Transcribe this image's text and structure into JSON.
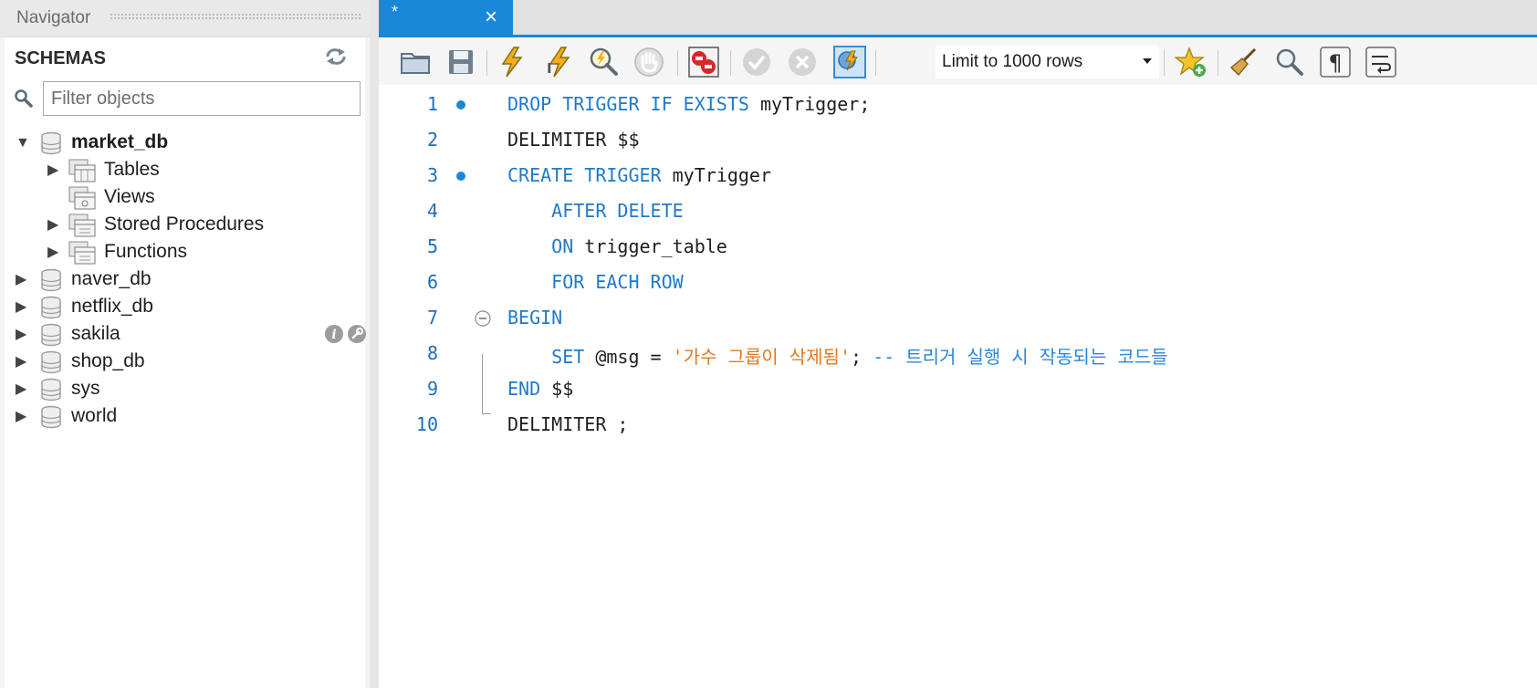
{
  "navigator": {
    "title": "Navigator",
    "schemas_label": "SCHEMAS",
    "filter_placeholder": "Filter objects",
    "tree": {
      "market_db": {
        "name": "market_db",
        "children": [
          "Tables",
          "Views",
          "Stored Procedures",
          "Functions"
        ]
      },
      "databases": [
        "naver_db",
        "netflix_db",
        "sakila",
        "shop_db",
        "sys",
        "world"
      ]
    }
  },
  "editor": {
    "tab_title": "*",
    "tab_close": "×",
    "limit_label": "Limit to 1000 rows",
    "colors": {
      "accent": "#1b87d8",
      "keyword": "#1f7ac9",
      "string": "#e07a1f",
      "comment": "#2a87d8",
      "line_number": "#1f6fb8"
    },
    "lines": [
      {
        "num": "1",
        "segments": [
          [
            "kw",
            "DROP TRIGGER IF EXISTS "
          ],
          [
            "",
            "myTrigger;"
          ]
        ]
      },
      {
        "num": "2",
        "segments": [
          [
            "",
            "DELIMITER $$"
          ]
        ]
      },
      {
        "num": "3",
        "segments": [
          [
            "kw",
            "CREATE TRIGGER "
          ],
          [
            "",
            "myTrigger"
          ]
        ]
      },
      {
        "num": "4",
        "segments": [
          [
            "kw",
            "    AFTER DELETE"
          ]
        ]
      },
      {
        "num": "5",
        "segments": [
          [
            "kw",
            "    ON "
          ],
          [
            "",
            "trigger_table"
          ]
        ]
      },
      {
        "num": "6",
        "segments": [
          [
            "kw",
            "    FOR EACH ROW"
          ]
        ]
      },
      {
        "num": "7",
        "segments": [
          [
            "kw",
            "BEGIN"
          ]
        ]
      },
      {
        "num": "8",
        "segments": [
          [
            "kw",
            "    SET "
          ],
          [
            "",
            "@msg = "
          ],
          [
            "str",
            "'가수 그룹이 삭제됨'"
          ],
          [
            "",
            "; "
          ],
          [
            "cmt",
            "-- 트리거 실행 시 작동되는 코드들"
          ]
        ]
      },
      {
        "num": "9",
        "segments": [
          [
            "kw",
            "END "
          ],
          [
            "",
            "$$"
          ]
        ]
      },
      {
        "num": "10",
        "segments": [
          [
            "",
            "DELIMITER ;"
          ]
        ]
      }
    ]
  }
}
